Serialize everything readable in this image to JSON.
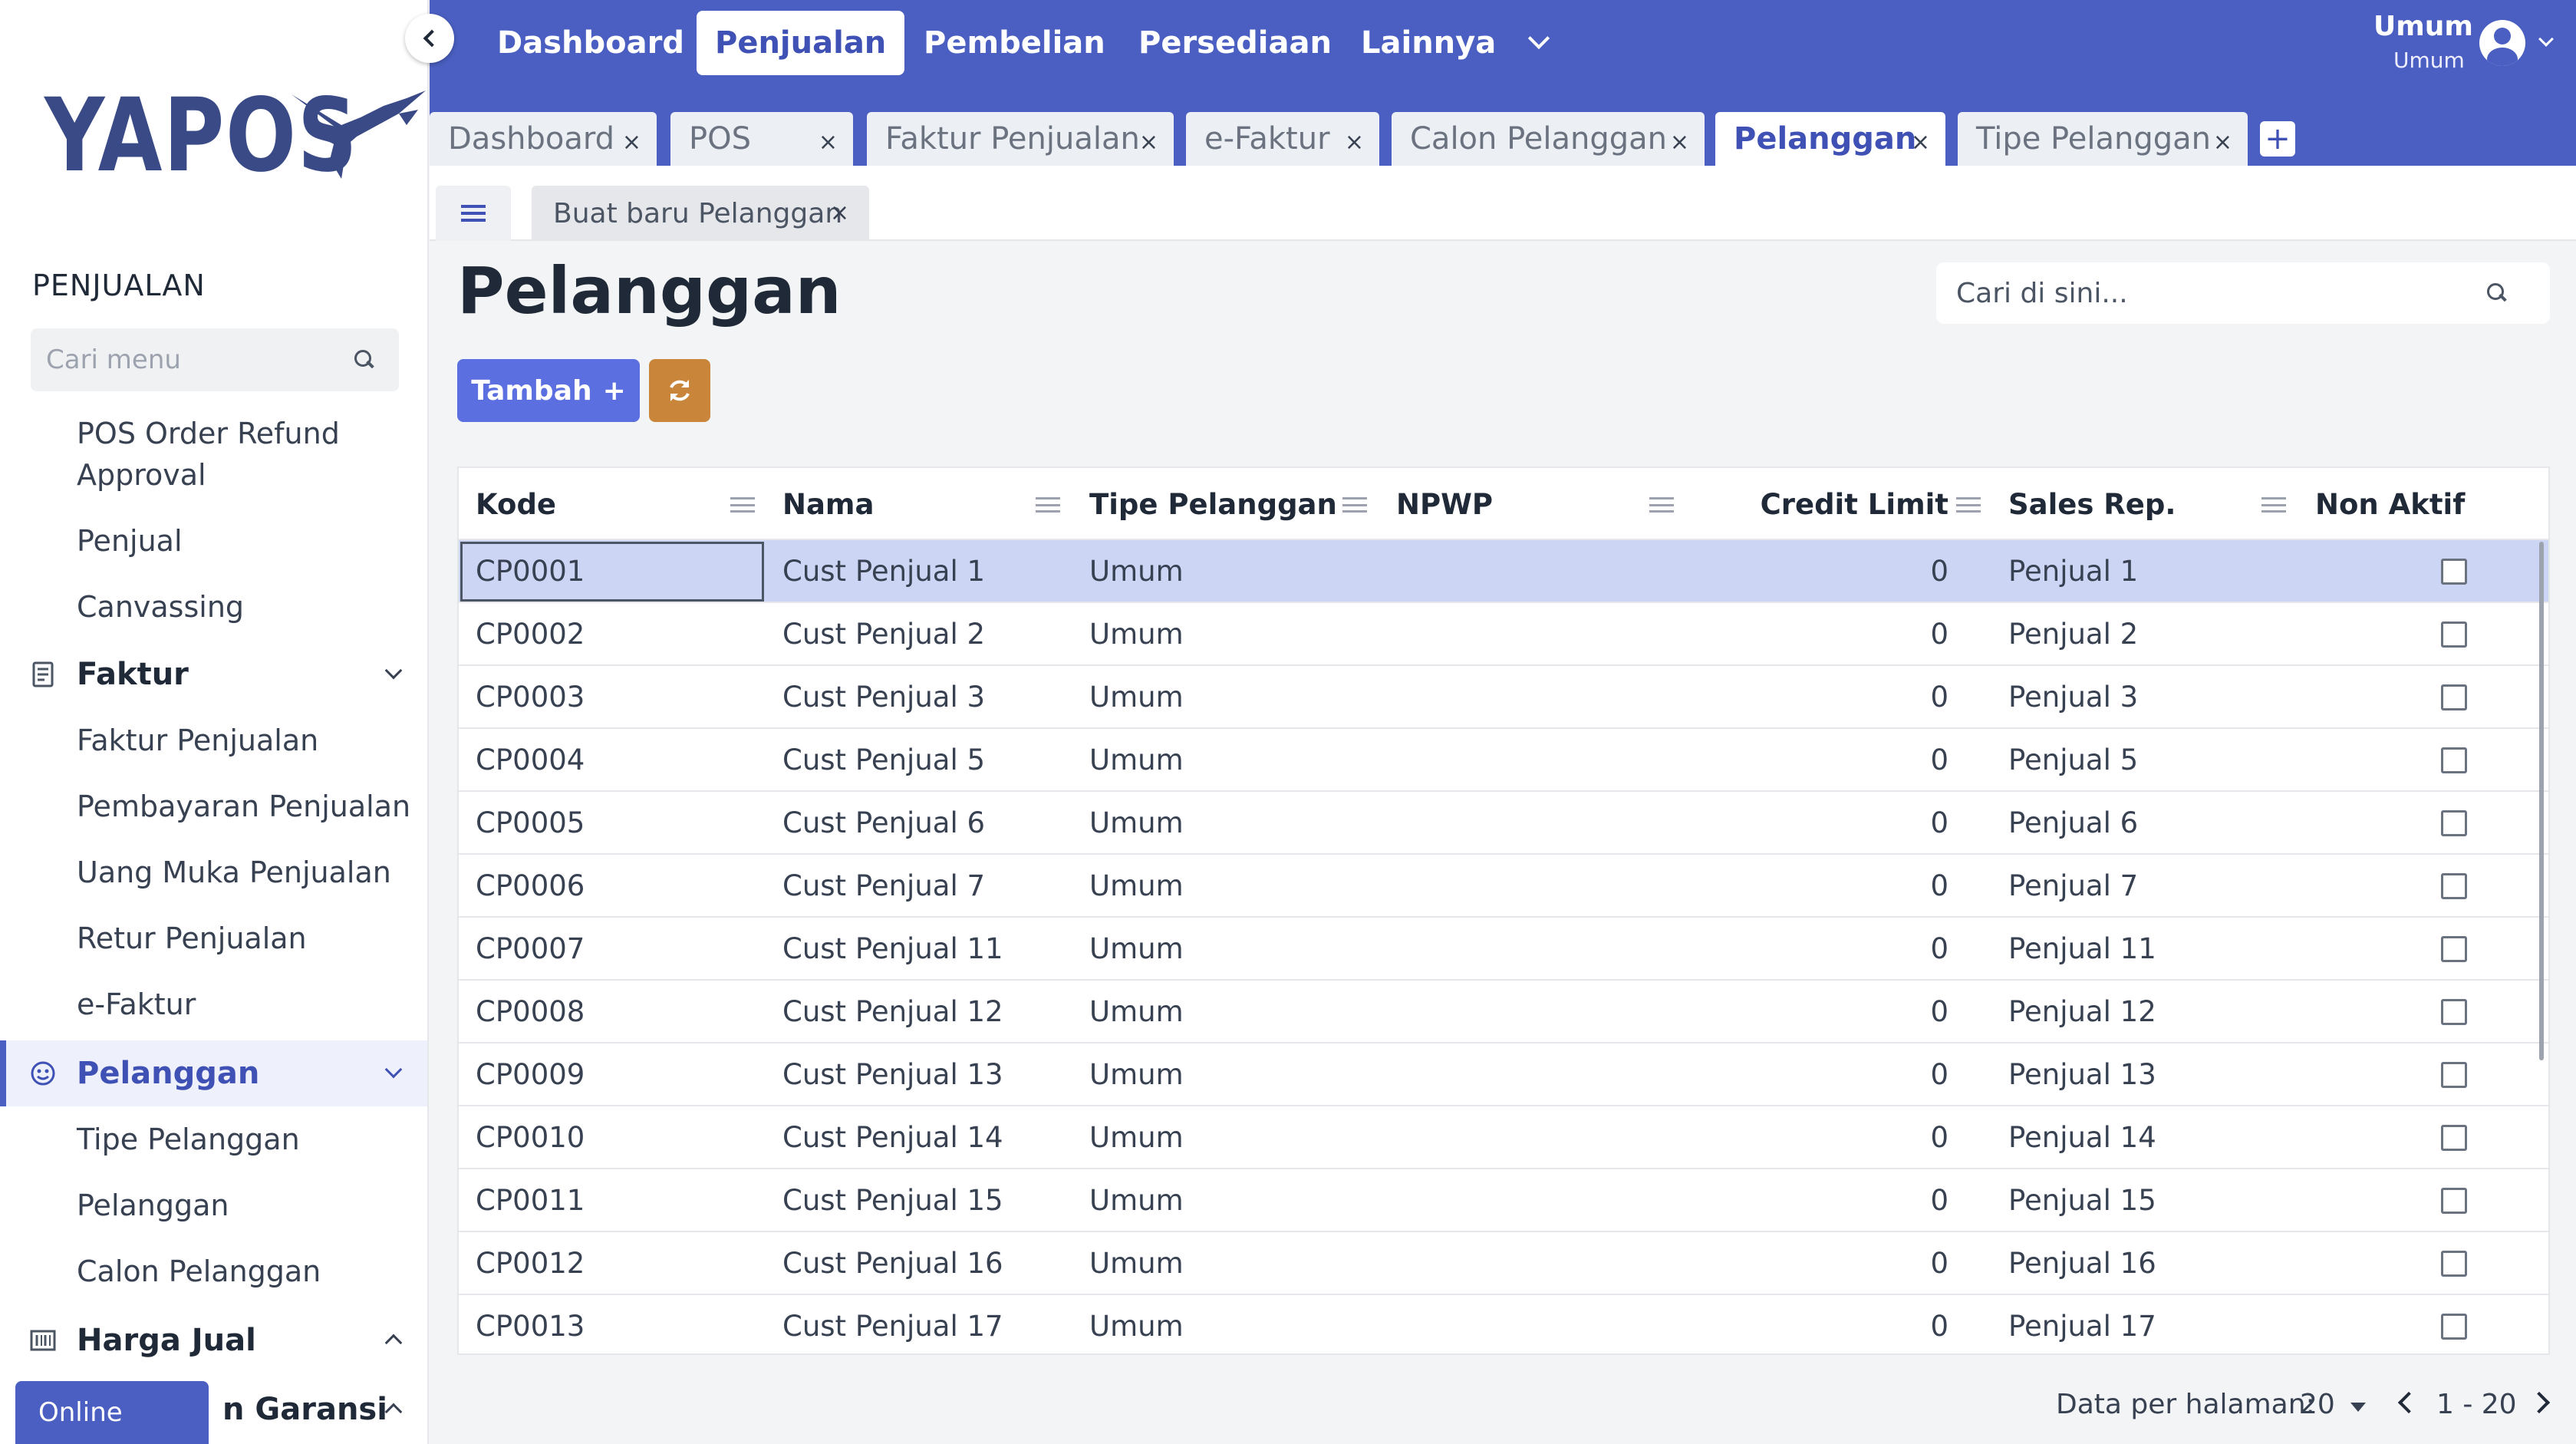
{
  "brand": {
    "name": "YAPOS",
    "color": "#3a4a86"
  },
  "colors": {
    "primary": "#4a5fc1",
    "add_button": "#5b6fe0",
    "refresh_button": "#c98539",
    "selected_row": "#cdd5f5"
  },
  "sidebar": {
    "section_title": "PENJUALAN",
    "search_placeholder": "Cari menu",
    "items_top": [
      "POS Order Refund",
      "Approval",
      "Penjual",
      "Canvassing"
    ],
    "group_faktur": {
      "label": "Faktur",
      "icon": "document-icon"
    },
    "faktur_items": [
      "Faktur Penjualan",
      "Pembayaran Penjualan",
      "Uang Muka Penjualan",
      "Retur Penjualan",
      "e-Faktur"
    ],
    "group_pelanggan": {
      "label": "Pelanggan",
      "icon": "smiley-icon"
    },
    "pelanggan_items": [
      "Tipe Pelanggan",
      "Pelanggan",
      "Calon Pelanggan"
    ],
    "group_harga": {
      "label": "Harga Jual",
      "icon": "barcode-icon"
    },
    "group_garansi": {
      "label": "n Garansi"
    },
    "status_badge": "Online"
  },
  "topnav": {
    "items": [
      "Dashboard",
      "Penjualan",
      "Pembelian",
      "Persediaan",
      "Lainnya"
    ],
    "active": "Penjualan",
    "user_name": "Umum",
    "user_role": "Umum"
  },
  "tabs": {
    "items": [
      "Dashboard",
      "POS",
      "Faktur Penjualan",
      "e-Faktur",
      "Calon Pelanggan",
      "Pelanggan",
      "Tipe Pelanggan"
    ],
    "active": "Pelanggan",
    "close_glyph": "×",
    "add_glyph": "+"
  },
  "subtab": {
    "label": "Buat baru Pelanggan"
  },
  "page": {
    "title": "Pelanggan",
    "search_placeholder": "Cari di sini...",
    "add_button": "Tambah",
    "add_glyph": "+"
  },
  "table": {
    "columns": [
      "Kode",
      "Nama",
      "Tipe Pelanggan",
      "NPWP",
      "Credit Limit",
      "Sales Rep.",
      "Non Aktif"
    ],
    "rows": [
      {
        "kode": "CP0001",
        "nama": "Cust Penjual 1",
        "tipe": "Umum",
        "npwp": "",
        "credit": "0",
        "sales": "Penjual 1",
        "nonaktif": false
      },
      {
        "kode": "CP0002",
        "nama": "Cust Penjual 2",
        "tipe": "Umum",
        "npwp": "",
        "credit": "0",
        "sales": "Penjual 2",
        "nonaktif": false
      },
      {
        "kode": "CP0003",
        "nama": "Cust Penjual 3",
        "tipe": "Umum",
        "npwp": "",
        "credit": "0",
        "sales": "Penjual 3",
        "nonaktif": false
      },
      {
        "kode": "CP0004",
        "nama": "Cust Penjual 5",
        "tipe": "Umum",
        "npwp": "",
        "credit": "0",
        "sales": "Penjual 5",
        "nonaktif": false
      },
      {
        "kode": "CP0005",
        "nama": "Cust Penjual 6",
        "tipe": "Umum",
        "npwp": "",
        "credit": "0",
        "sales": "Penjual 6",
        "nonaktif": false
      },
      {
        "kode": "CP0006",
        "nama": "Cust Penjual 7",
        "tipe": "Umum",
        "npwp": "",
        "credit": "0",
        "sales": "Penjual 7",
        "nonaktif": false
      },
      {
        "kode": "CP0007",
        "nama": "Cust Penjual 11",
        "tipe": "Umum",
        "npwp": "",
        "credit": "0",
        "sales": "Penjual 11",
        "nonaktif": false
      },
      {
        "kode": "CP0008",
        "nama": "Cust Penjual 12",
        "tipe": "Umum",
        "npwp": "",
        "credit": "0",
        "sales": "Penjual 12",
        "nonaktif": false
      },
      {
        "kode": "CP0009",
        "nama": "Cust Penjual 13",
        "tipe": "Umum",
        "npwp": "",
        "credit": "0",
        "sales": "Penjual 13",
        "nonaktif": false
      },
      {
        "kode": "CP0010",
        "nama": "Cust Penjual 14",
        "tipe": "Umum",
        "npwp": "",
        "credit": "0",
        "sales": "Penjual 14",
        "nonaktif": false
      },
      {
        "kode": "CP0011",
        "nama": "Cust Penjual 15",
        "tipe": "Umum",
        "npwp": "",
        "credit": "0",
        "sales": "Penjual 15",
        "nonaktif": false
      },
      {
        "kode": "CP0012",
        "nama": "Cust Penjual 16",
        "tipe": "Umum",
        "npwp": "",
        "credit": "0",
        "sales": "Penjual 16",
        "nonaktif": false
      },
      {
        "kode": "CP0013",
        "nama": "Cust Penjual 17",
        "tipe": "Umum",
        "npwp": "",
        "credit": "0",
        "sales": "Penjual 17",
        "nonaktif": false
      }
    ],
    "selected_row": 0
  },
  "pagination": {
    "label": "Data per halaman:",
    "page_size": "20",
    "range": "1 - 20"
  }
}
